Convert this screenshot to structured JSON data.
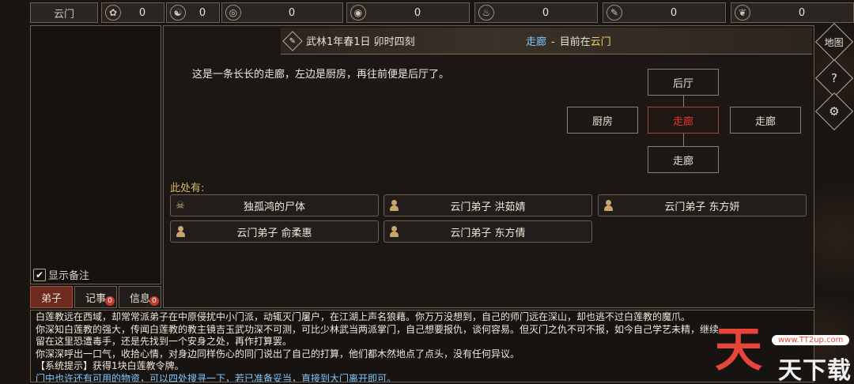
{
  "topbar": {
    "sect_name": "云门",
    "resources": [
      {
        "icon": "spirit-icon",
        "glyph": "✿",
        "value": "0"
      },
      {
        "icon": "yin-yang-icon",
        "glyph": "☯",
        "value": "0"
      },
      {
        "icon": "coin-icon",
        "glyph": "◎",
        "value": "0"
      },
      {
        "icon": "food-bowl-icon",
        "glyph": "◉",
        "value": "0"
      },
      {
        "icon": "herb-icon",
        "glyph": "♨",
        "value": "0"
      },
      {
        "icon": "scroll-icon",
        "glyph": "✎",
        "value": "0"
      },
      {
        "icon": "beast-icon",
        "glyph": "❦",
        "value": "0"
      }
    ]
  },
  "left": {
    "show_notes": "显示备注",
    "tabs": [
      {
        "label": "弟子",
        "badge": ""
      },
      {
        "label": "记事",
        "badge": "0"
      },
      {
        "label": "信息",
        "badge": "0"
      }
    ]
  },
  "header": {
    "date": "武林1年春1日 卯时四刻",
    "current_room": "走廊",
    "separator": "-",
    "now_in": "目前在",
    "town": "云门"
  },
  "description": "这是一条长长的走廊，左边是厨房，再往前便是后厅了。",
  "map": {
    "north": "后厅",
    "west": "厨房",
    "center": "走廊",
    "east": "走廊",
    "south": "走廊"
  },
  "here_label": "此处有:",
  "entities": [
    {
      "type": "corpse",
      "name": "独孤鸿的尸体"
    },
    {
      "type": "person",
      "name": "云门弟子  洪茹婧"
    },
    {
      "type": "person",
      "name": "云门弟子  东方妍"
    },
    {
      "type": "person",
      "name": "云门弟子  俞柔惠"
    },
    {
      "type": "person",
      "name": "云门弟子  东方倩"
    }
  ],
  "side_icons": [
    {
      "name": "map-icon",
      "glyph": "地图"
    },
    {
      "name": "help-icon",
      "glyph": "?"
    },
    {
      "name": "settings-icon",
      "glyph": "⚙"
    }
  ],
  "log": [
    "白莲教远在西域，却常常派弟子在中原侵扰中小门派，动辄灭门屠户，在江湖上声名狼藉。你万万没想到，自己的师门远在深山，却也逃不过白莲教的魔爪。",
    "你深知白莲教的强大，传闻白莲教的教主镜吉玉武功深不可测，可比少林武当两派掌门，自己想要报仇，谈何容易。但灭门之仇不可不报，如今自己学艺未精，继续",
    "留在这里恐遭毒手，还是先找到一个安身之处，再作打算罢。",
    "你深深呼出一口气，收拾心情，对身边同样伤心的同门说出了自己的打算，他们都木然地点了点头，没有任何异议。",
    "【系统提示】获得1块白莲教令牌。",
    "门中也许还有可用的物资，可以四处搜寻一下，若已准备妥当，直接到大门离开即可。"
  ],
  "watermark": {
    "big": "天",
    "small": "天下载",
    "url": "www.TT2up.com"
  }
}
